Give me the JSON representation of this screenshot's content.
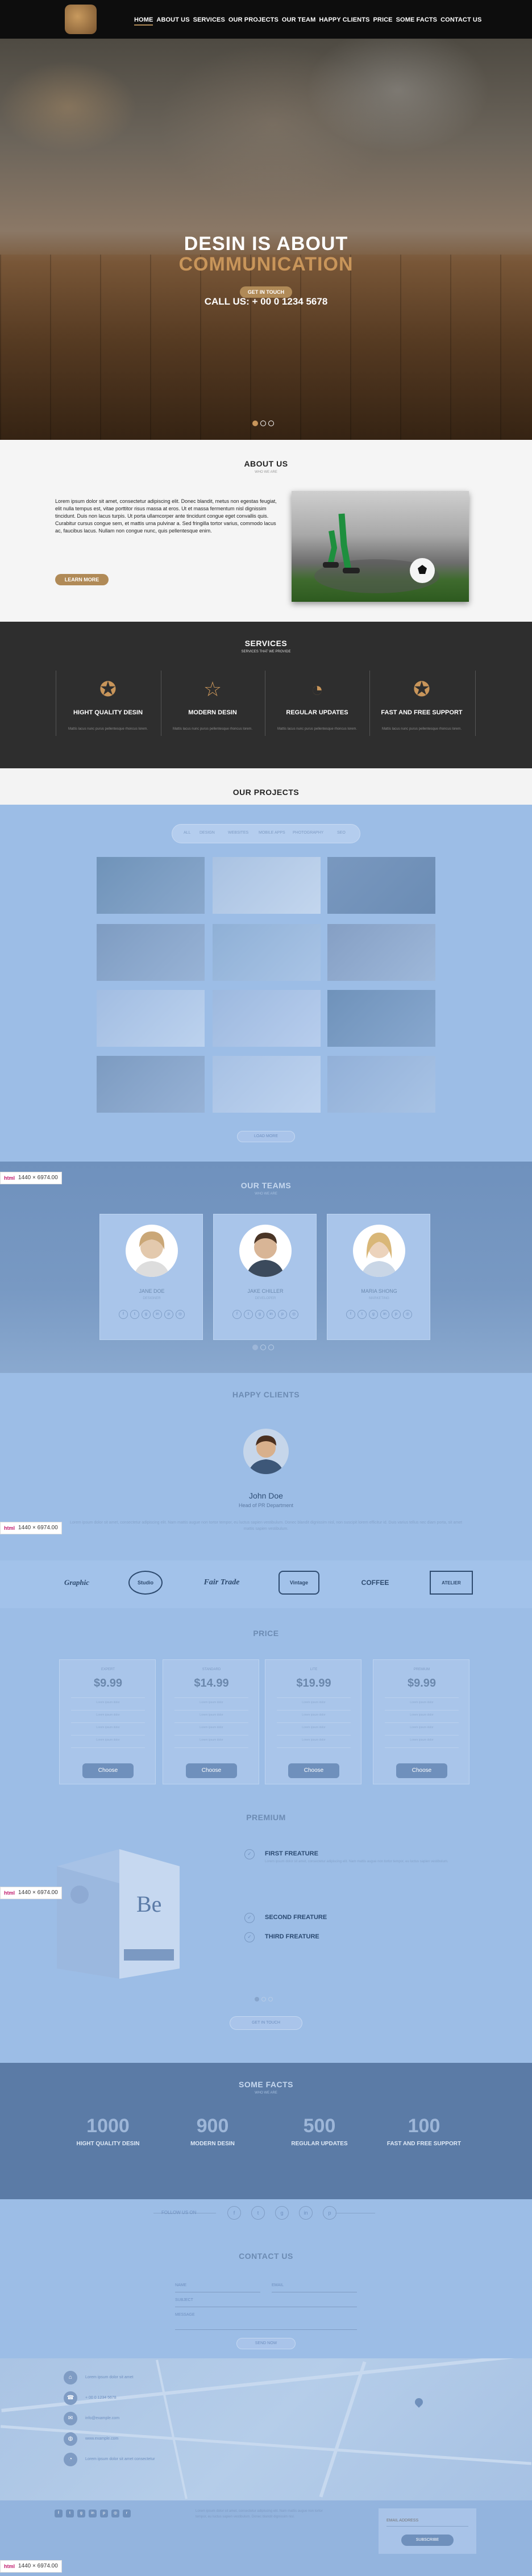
{
  "nav": {
    "items": [
      "HOME",
      "ABOUT US",
      "SERVICES",
      "OUR PROJECTS",
      "OUR TEAM",
      "HAPPY CLIENTS",
      "PRICE",
      "SOME FACTS",
      "CONTACT US"
    ]
  },
  "hero": {
    "title_line1": "DESIN IS ABOUT",
    "title_line2": "COMMUNICATION",
    "call": "CALL US: + 00 0 1234 5678",
    "button": "GET IN TOUCH"
  },
  "about": {
    "title": "ABOUT US",
    "subtitle": "WHO WE ARE",
    "text": "Lorem ipsum dolor sit amet, consectetur adipiscing elit. Donec blandit, metus non egestas feugiat, elit nulla tempus est, vitae porttitor risus massa at eros. Ut et massa fermentum nisl dignissim tincidunt. Duis non lacus turpis. Ut porta ullamcorper ante tincidunt congue eget convallis quis. Curabitur cursus congue sem, et mattis urna pulvinar a. Sed fringilla tortor varius, commodo lacus ac, faucibus lacus. Nullam non congue nunc, quis pellentesque enim.",
    "button": "LEARN MORE"
  },
  "services": {
    "title": "SERVICES",
    "subtitle": "SERVICES THAT WE PROVIDE",
    "items": [
      {
        "title": "HIGHT QUALITY DESIN",
        "desc": "Mattis lacus nunc purus pellentesque rhoncus lorem."
      },
      {
        "title": "MODERN DESIN",
        "desc": "Mattis lacus nunc purus pellentesque rhoncus lorem."
      },
      {
        "title": "REGULAR UPDATES",
        "desc": "Mattis lacus nunc purus pellentesque rhoncus lorem."
      },
      {
        "title": "FAST AND FREE SUPPORT",
        "desc": "Mattis lacus nunc purus pellentesque rhoncus lorem."
      }
    ]
  },
  "projects": {
    "title": "OUR PROJECTS",
    "filters": [
      "ALL",
      "DESIGN",
      "WEBSITES",
      "MOBILE APPS",
      "PHOTOGRAPHY",
      "SEO"
    ],
    "button": "LOAD MORE"
  },
  "team": {
    "title": "OUR TEAMS",
    "subtitle": "WHO WE ARE",
    "members": [
      {
        "name": "JANE DOE",
        "role": "DESIGNER"
      },
      {
        "name": "JAKE CHILLER",
        "role": "DEVELOPER"
      },
      {
        "name": "MARIA SHONG",
        "role": "MARKETING"
      }
    ]
  },
  "clients": {
    "title": "HAPPY CLIENTS",
    "name": "John Doe",
    "role": "Head of PR Department",
    "quote": "Lorem ipsum dolor sit amet, consectetur adipiscing elit. Nam mattis augue non tortor tempor, eu luctus sapien vestibulum. Donec blandit dignissim nisl, non suscipit lorem efficitur id. Duis varius tellus nec diam porta, sit amet mattis sapien vestibulum.",
    "logos": [
      "Graphic",
      "Studio",
      "Fair Trade",
      "Vintage",
      "COFFEE",
      "ATELIER"
    ]
  },
  "price": {
    "title": "PRICE",
    "plans": [
      {
        "name": "EXPERT",
        "value": "$9.99"
      },
      {
        "name": "STANDARD",
        "value": "$14.99"
      },
      {
        "name": "LITE",
        "value": "$19.99"
      },
      {
        "name": "PREMIUM",
        "value": "$9.99"
      }
    ],
    "features": [
      "Lorem ipsum dolor",
      "Lorem ipsum dolor",
      "Lorem ipsum dolor",
      "Lorem ipsum dolor"
    ],
    "button": "Choose"
  },
  "premium": {
    "title": "PREMIUM",
    "features": [
      {
        "title": "FIRST FREATURE",
        "desc": "Lorem ipsum dolor sit amet, consectetur adipiscing elit. Nam mattis augue non tortor tempor, eu luctus sapien vestibulum."
      },
      {
        "title": "SECOND FREATURE",
        "desc": ""
      },
      {
        "title": "THIRD FREATURE",
        "desc": ""
      }
    ],
    "button": "GET IN TOUCH"
  },
  "facts": {
    "title": "SOME FACTS",
    "subtitle": "WHO WE ARE",
    "items": [
      {
        "num": "1000",
        "label": "HIGHT QUALITY DESIN"
      },
      {
        "num": "900",
        "label": "MODERN DESIN"
      },
      {
        "num": "500",
        "label": "REGULAR UPDATES"
      },
      {
        "num": "100",
        "label": "FAST AND FREE SUPPORT"
      }
    ]
  },
  "follow": {
    "label": "FOLLOW US ON"
  },
  "contact": {
    "title": "CONTACT US",
    "fields": [
      "NAME",
      "EMAIL",
      "SUBJECT",
      "MESSAGE"
    ],
    "button": "SEND NOW"
  },
  "map": {
    "info": [
      "Lorem ipsum dolor sit amet",
      "+ 00 0 1234 5678",
      "info@example.com",
      "www.example.com",
      "Lorem ipsum dolor sit amet consectetur"
    ]
  },
  "footer": {
    "text": "Lorem ipsum dolor sit amet, consectetur adipiscing elit. Nam mattis augue non tortor tempor, eu luctus sapien vestibulum. Donec blandit dignissim nisl.",
    "subscribe_placeholder": "EMAIL ADDRESS",
    "subscribe_button": "SUBSCRIBE"
  },
  "badge": {
    "label": "html",
    "size": "1440 × 6974.00"
  },
  "colors": {
    "accent": "#b08a57",
    "dark": "#2e2e2e",
    "overlay": "#9cbde6"
  }
}
